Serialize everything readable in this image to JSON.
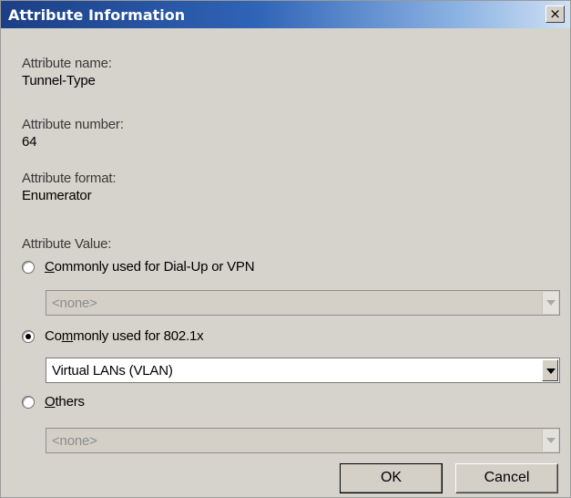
{
  "dialog": {
    "title": "Attribute Information",
    "close_label": "×"
  },
  "fields": {
    "name_label": "Attribute name:",
    "name_value": "Tunnel-Type",
    "number_label": "Attribute number:",
    "number_value": "64",
    "format_label": "Attribute format:",
    "format_value": "Enumerator",
    "value_label": "Attribute Value:"
  },
  "options": [
    {
      "label_prefix": "",
      "label_mnemonic": "C",
      "label_rest": "ommonly used for Dial-Up or VPN",
      "checked": false,
      "combo_value": "<none>",
      "combo_enabled": false
    },
    {
      "label_prefix": "Co",
      "label_mnemonic": "m",
      "label_rest": "monly used for 802.1x",
      "checked": true,
      "combo_value": "Virtual LANs (VLAN)",
      "combo_enabled": true
    },
    {
      "label_prefix": "",
      "label_mnemonic": "O",
      "label_rest": "thers",
      "checked": false,
      "combo_value": "<none>",
      "combo_enabled": false
    }
  ],
  "buttons": {
    "ok_label": "OK",
    "cancel_label": "Cancel"
  }
}
